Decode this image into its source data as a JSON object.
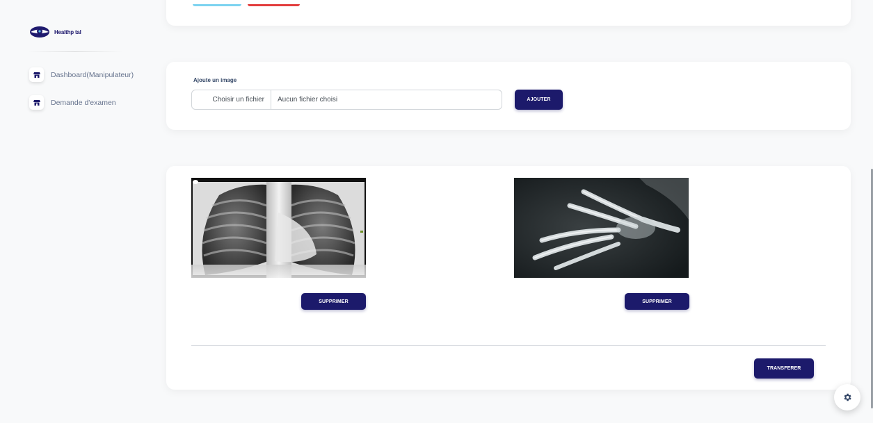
{
  "brand": {
    "name": "Healthp tal",
    "logo_icon": "eye-logo-icon"
  },
  "sidebar": {
    "items": [
      {
        "label": "Dashboard(Manipulateur)",
        "icon": "shop-icon"
      },
      {
        "label": "Demande d'examen",
        "icon": "shop-icon"
      }
    ]
  },
  "upload": {
    "label": "Ajoute un image",
    "choose_button": "Choisir un fichier",
    "file_name": "Aucun fichier choisi",
    "add_button": "AJOUTER"
  },
  "images": [
    {
      "description": "chest-xray",
      "delete_button": "SUPPRIMER"
    },
    {
      "description": "hand-xray",
      "delete_button": "SUPPRIMER"
    }
  ],
  "transfer_button": "TRANSFERER",
  "colors": {
    "primary": "#1c1a6b",
    "background": "#f8f9fa",
    "accent_blue": "#7dd3f0",
    "accent_red": "#e23d3d"
  }
}
